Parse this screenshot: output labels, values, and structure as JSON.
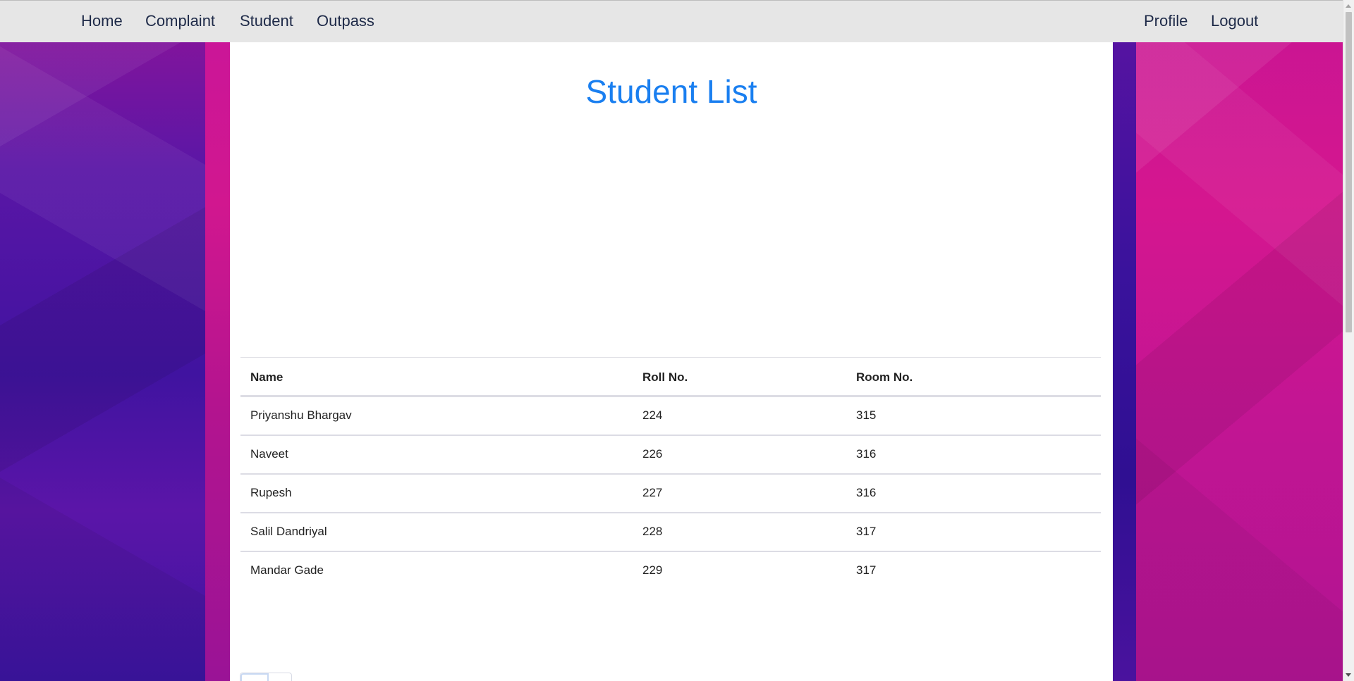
{
  "nav": {
    "left": [
      "Home",
      "Complaint",
      "Student",
      "Outpass"
    ],
    "right": [
      "Profile",
      "Logout"
    ]
  },
  "page": {
    "title": "Student List"
  },
  "table": {
    "headers": [
      "Name",
      "Roll No.",
      "Room No."
    ],
    "rows": [
      [
        "Priyanshu Bhargav",
        "224",
        "315"
      ],
      [
        "Naveet",
        "226",
        "316"
      ],
      [
        "Rupesh",
        "227",
        "316"
      ],
      [
        "Salil Dandriyal",
        "228",
        "317"
      ],
      [
        "Mandar Gade",
        "229",
        "317"
      ]
    ]
  },
  "colors": {
    "title": "#1a7ff0",
    "nav_background": "#e6e6e6",
    "nav_text": "#1e2a48",
    "background_purple": "#4013a0",
    "background_magenta": "#d3168e"
  }
}
